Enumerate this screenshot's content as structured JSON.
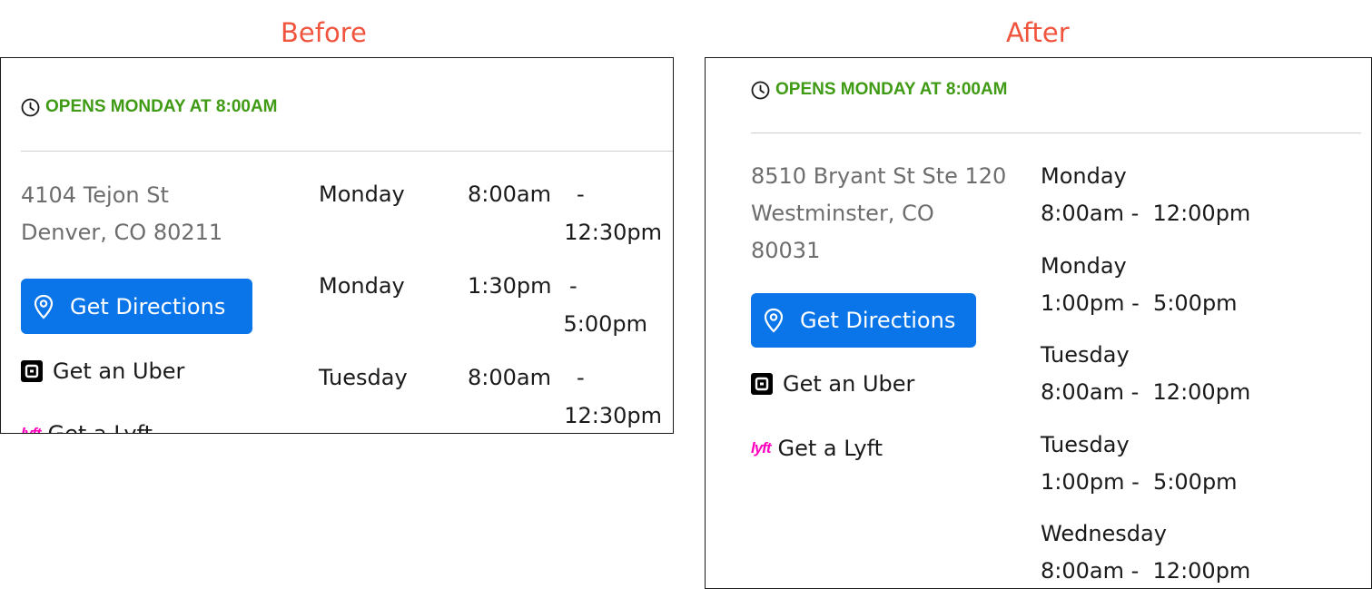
{
  "captions": {
    "before": "Before",
    "after": "After"
  },
  "colors": {
    "status_green": "#3f9a14",
    "button_blue": "#0a74e9",
    "caption_red": "#f0543c",
    "lyft_pink": "#ff00bf",
    "address_gray": "#6d6d6d"
  },
  "before": {
    "clipped_heading": "",
    "status": {
      "icon": "clock-icon",
      "text": "OPENS MONDAY AT 8:00AM"
    },
    "address": {
      "line1": "4104 Tejon St",
      "line2": "Denver, CO 80211"
    },
    "directions": {
      "icon": "map-pin-icon",
      "label": "Get Directions"
    },
    "uber": {
      "icon": "uber-icon",
      "label": "Get an Uber"
    },
    "lyft": {
      "icon": "lyft-icon",
      "label": "Get a Lyft"
    },
    "hours": [
      {
        "day": "Monday",
        "open": "8:00am",
        "sep": "-",
        "close": "12:30pm"
      },
      {
        "day": "Monday",
        "open": "1:30pm",
        "sep": "-",
        "close": "5:00pm"
      },
      {
        "day": "Tuesday",
        "open": "8:00am",
        "sep": "-",
        "close": "12:30pm"
      }
    ]
  },
  "after": {
    "status": {
      "icon": "clock-icon",
      "text": "OPENS MONDAY AT 8:00AM"
    },
    "address": {
      "line1": "8510 Bryant St Ste 120",
      "line2": "Westminster, CO",
      "line3": "80031"
    },
    "directions": {
      "icon": "map-pin-icon",
      "label": "Get Directions"
    },
    "uber": {
      "icon": "uber-icon",
      "label": "Get an Uber"
    },
    "lyft": {
      "icon": "lyft-icon",
      "label": "Get a Lyft"
    },
    "hours": [
      {
        "day": "Monday",
        "times": "8:00am -  12:00pm"
      },
      {
        "day": "Monday",
        "times": "1:00pm -  5:00pm"
      },
      {
        "day": "Tuesday",
        "times": "8:00am -  12:00pm"
      },
      {
        "day": "Tuesday",
        "times": "1:00pm -  5:00pm"
      },
      {
        "day": "Wednesday",
        "times": "8:00am -  12:00pm"
      }
    ]
  }
}
